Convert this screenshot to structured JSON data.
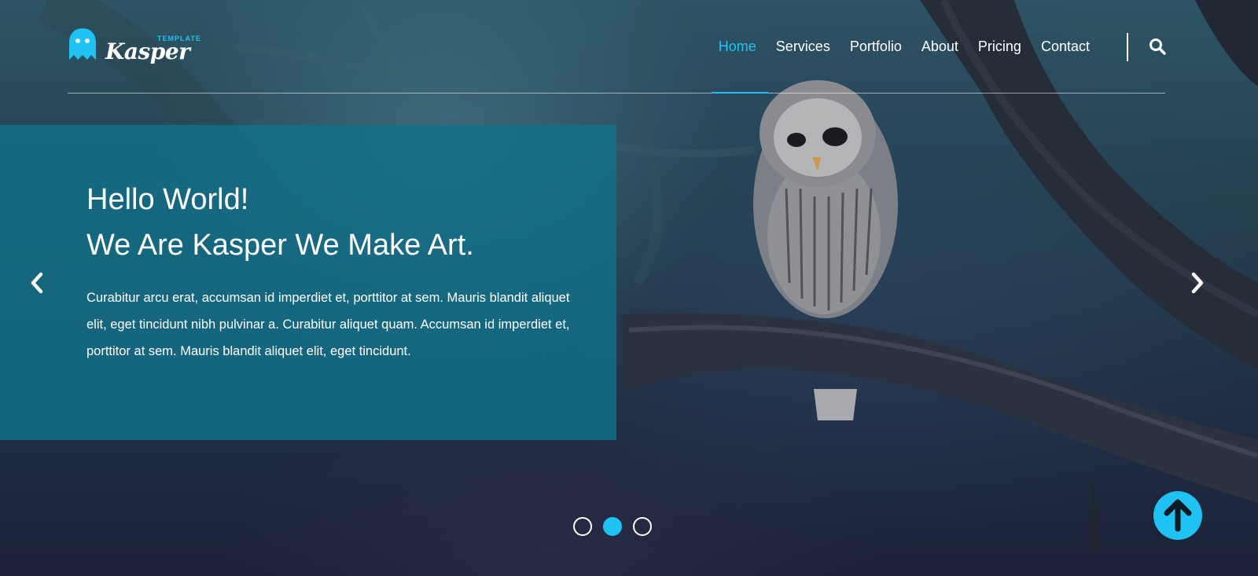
{
  "brand": {
    "name": "Kasper",
    "tagline": "TEMPLATE",
    "accent_color": "#1fc2f0",
    "icon": "ghost-icon"
  },
  "nav": {
    "items": [
      {
        "label": "Home",
        "active": true
      },
      {
        "label": "Services",
        "active": false
      },
      {
        "label": "Portfolio",
        "active": false
      },
      {
        "label": "About",
        "active": false
      },
      {
        "label": "Pricing",
        "active": false
      },
      {
        "label": "Contact",
        "active": false
      }
    ],
    "search_icon": "search-icon"
  },
  "slide": {
    "heading_line1": "Hello World!",
    "heading_line2": "We Are Kasper We Make Art.",
    "body": "Curabitur arcu erat, accumsan id imperdiet et, porttitor at sem. Mauris blandit aliquet elit, eget tincidunt nibh pulvinar a. Curabitur aliquet quam. Accumsan id imperdiet et, porttitor at sem. Mauris blandit aliquet elit, eget tincidunt.",
    "box_color": "#12708a"
  },
  "carousel": {
    "prev_icon": "chevron-left-icon",
    "next_icon": "chevron-right-icon",
    "bullet_count": 3,
    "active_index": 1
  },
  "scroll_top": {
    "icon": "arrow-up-icon"
  }
}
